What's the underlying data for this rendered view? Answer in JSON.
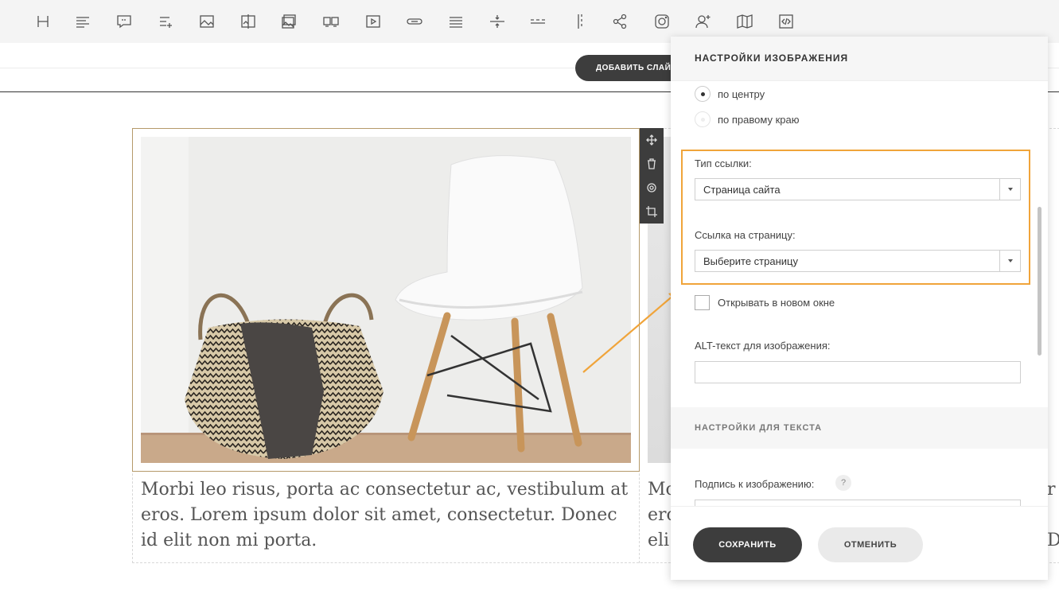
{
  "toolbar": {
    "icons": [
      "heading-icon",
      "paragraph-icon",
      "quote-icon",
      "list-add-icon",
      "image-icon",
      "image-compare-icon",
      "gallery-icon",
      "slider-icon",
      "video-icon",
      "link-button-icon",
      "lines-icon",
      "divider-icon",
      "dashed-divider-icon",
      "vertical-divider-icon",
      "share-icon",
      "instagram-icon",
      "user-add-icon",
      "map-icon",
      "code-icon"
    ]
  },
  "subbar": {
    "add_slide_label": "ДОБАВИТЬ СЛАЙД"
  },
  "slide": {
    "caption": "Morbi leo risus, porta ac consectetur ac, vestibulum at eros. Lorem ipsum dolor sit amet, consectetur. Donec id elit non mi porta.",
    "caption2_lines": [
      "Mo",
      "ero",
      "eli"
    ],
    "caption3_lines": [
      "r",
      "",
      "D"
    ]
  },
  "panel": {
    "title": "НАСТРОЙКИ ИЗОБРАЖЕНИЯ",
    "align_options": [
      {
        "label": "по центру",
        "selected": true
      },
      {
        "label": "по правому краю",
        "selected": false
      }
    ],
    "link_type_label": "Тип ссылки:",
    "link_type_value": "Страница сайта",
    "page_link_label": "Ссылка на страницу:",
    "page_link_value": "Выберите страницу",
    "new_window_label": "Открывать в новом окне",
    "new_window_checked": false,
    "alt_label": "ALT-текст для изображения:",
    "alt_value": "",
    "text_section_title": "НАСТРОЙКИ ДЛЯ ТЕКСТА",
    "caption_label": "Подпись к изображению:",
    "help_symbol": "?",
    "save_label": "СОХРАНИТЬ",
    "cancel_label": "ОТМЕНИТЬ"
  },
  "colors": {
    "accent": "#f0a43a",
    "dark_button": "#3d3d3d",
    "frame": "#b59a6a"
  }
}
